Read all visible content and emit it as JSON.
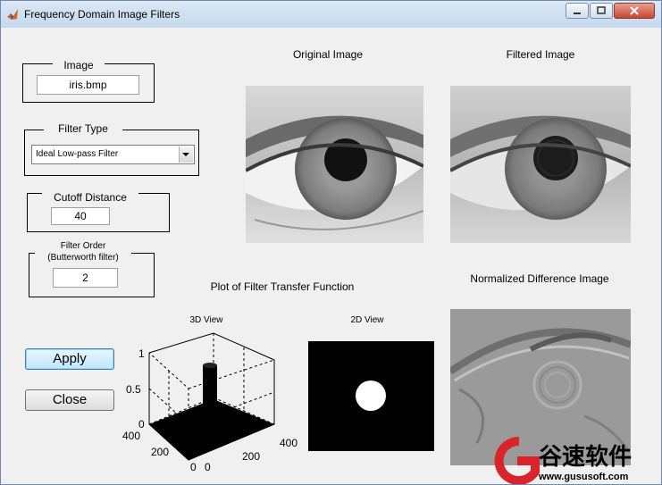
{
  "window": {
    "title": "Frequency Domain Image Filters"
  },
  "image_group": {
    "label": "Image",
    "value": "iris.bmp"
  },
  "filter_type_group": {
    "label": "Filter Type",
    "selected": "Ideal Low-pass Filter"
  },
  "cutoff_group": {
    "label": "Cutoff Distance",
    "value": "40"
  },
  "order_group": {
    "label_line1": "Filter Order",
    "label_line2": "(Butterworth filter)",
    "value": "2"
  },
  "buttons": {
    "apply": "Apply",
    "close": "Close"
  },
  "images": {
    "original_title": "Original Image",
    "filtered_title": "Filtered Image",
    "difference_title": "Normalized Difference Image"
  },
  "plots": {
    "section_title": "Plot of Filter Transfer Function",
    "view3d_title": "3D View",
    "view2d_title": "2D View",
    "z_ticks": [
      "1",
      "0.5",
      "0"
    ],
    "y_ticks": [
      "400",
      "200",
      "0"
    ],
    "x_ticks": [
      "0",
      "200",
      "400"
    ]
  },
  "watermark": {
    "brand_text": "谷速软件",
    "url": "www.gususoft.com"
  },
  "colors": {
    "titlebar": "#c4d8ec",
    "window_bg": "#f0f0f0",
    "close_button": "#c7452f",
    "focus_button": "#bee6fd",
    "watermark_red": "#d8242a"
  }
}
